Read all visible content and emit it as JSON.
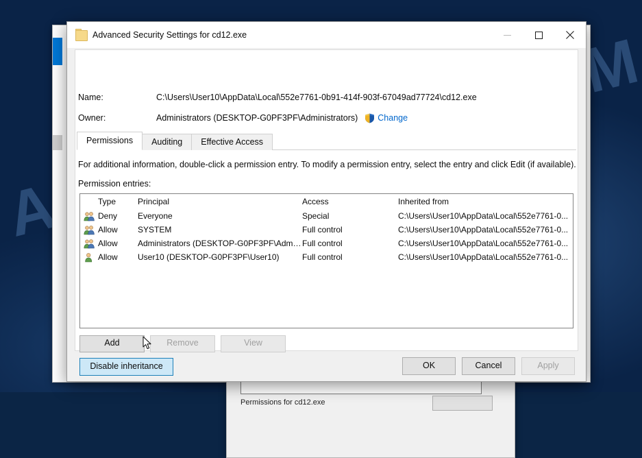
{
  "desktop": {
    "watermark": "ANTISPYWARE.COM"
  },
  "background_window": {
    "properties_hint": "Permissions for cd12.exe",
    "button_label": ""
  },
  "dialog": {
    "title": "Advanced Security Settings for cd12.exe",
    "title_icon": "folder-icon",
    "window_controls": {
      "minimize": "minimize-icon",
      "maximize": "maximize-icon",
      "close": "close-icon"
    },
    "fields": {
      "name_label": "Name:",
      "name_value": "C:\\Users\\User10\\AppData\\Local\\552e7761-0b91-414f-903f-67049ad77724\\cd12.exe",
      "owner_label": "Owner:",
      "owner_value": "Administrators (DESKTOP-G0PF3PF\\Administrators)",
      "change_link": "Change",
      "change_icon": "shield-icon"
    },
    "tabs": [
      {
        "label": "Permissions",
        "active": true
      },
      {
        "label": "Auditing",
        "active": false
      },
      {
        "label": "Effective Access",
        "active": false
      }
    ],
    "description": "For additional information, double-click a permission entry. To modify a permission entry, select the entry and click Edit (if available).",
    "entries_label": "Permission entries:",
    "table": {
      "columns": [
        "",
        "Type",
        "Principal",
        "Access",
        "Inherited from"
      ],
      "rows": [
        {
          "icon": "group-icon",
          "type": "Deny",
          "principal": "Everyone",
          "access": "Special",
          "inherited_from": "C:\\Users\\User10\\AppData\\Local\\552e7761-0..."
        },
        {
          "icon": "group-icon",
          "type": "Allow",
          "principal": "SYSTEM",
          "access": "Full control",
          "inherited_from": "C:\\Users\\User10\\AppData\\Local\\552e7761-0..."
        },
        {
          "icon": "group-icon",
          "type": "Allow",
          "principal": "Administrators (DESKTOP-G0PF3PF\\Admini...",
          "access": "Full control",
          "inherited_from": "C:\\Users\\User10\\AppData\\Local\\552e7761-0..."
        },
        {
          "icon": "user-icon",
          "type": "Allow",
          "principal": "User10 (DESKTOP-G0PF3PF\\User10)",
          "access": "Full control",
          "inherited_from": "C:\\Users\\User10\\AppData\\Local\\552e7761-0..."
        }
      ]
    },
    "buttons": {
      "add": "Add",
      "remove": "Remove",
      "view": "View",
      "disable_inheritance": "Disable inheritance"
    },
    "footer": {
      "ok": "OK",
      "cancel": "Cancel",
      "apply": "Apply"
    }
  },
  "colors": {
    "accent_link": "#0066cc",
    "highlight_button_bg": "#cde8f7",
    "highlight_button_border": "#1c7fb8",
    "desktop": "#0a2347"
  }
}
